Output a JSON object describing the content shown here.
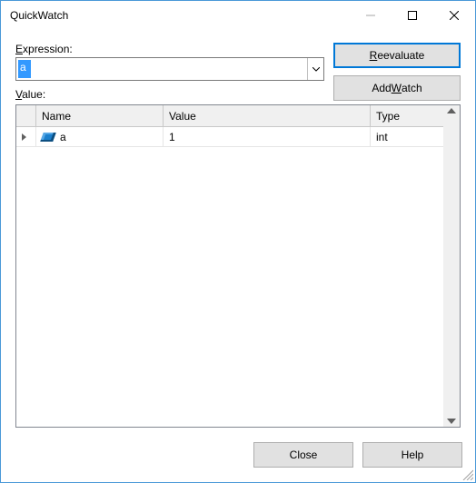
{
  "window": {
    "title": "QuickWatch"
  },
  "labels": {
    "expression": "Expression:",
    "value": "Value:"
  },
  "expression": {
    "value": "a"
  },
  "buttons": {
    "reevaluate_pre": "",
    "reevaluate_m": "R",
    "reevaluate_post": "eevaluate",
    "addwatch_pre": "Add ",
    "addwatch_m": "W",
    "addwatch_post": "atch",
    "close": "Close",
    "help": "Help"
  },
  "grid": {
    "headers": {
      "name": "Name",
      "value": "Value",
      "type": "Type"
    },
    "rows": [
      {
        "name": "a",
        "value": "1",
        "type": "int"
      }
    ]
  }
}
